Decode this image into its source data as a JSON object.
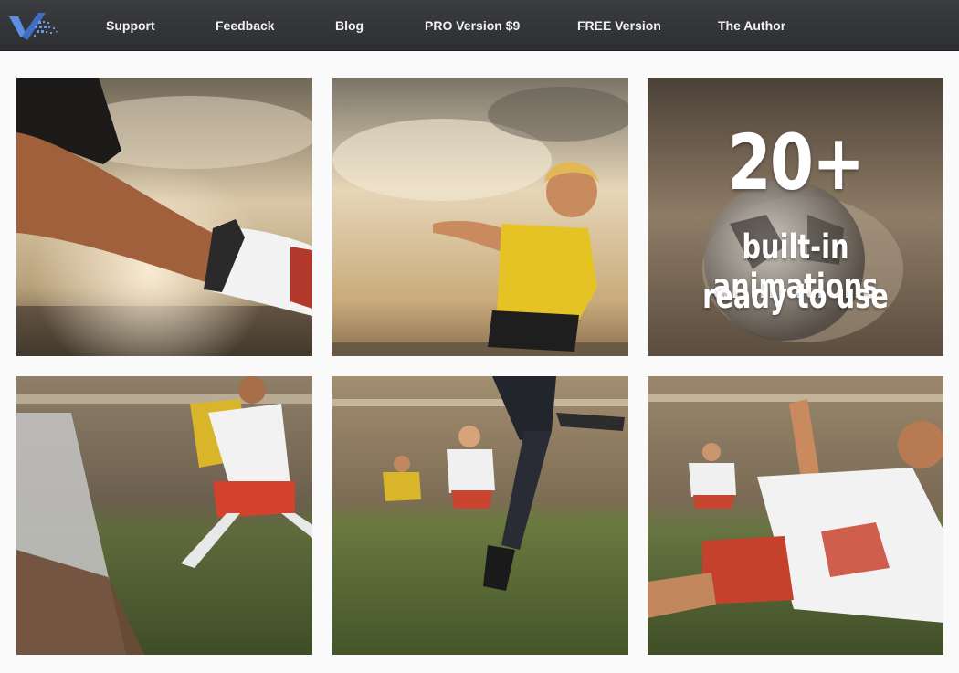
{
  "nav": {
    "items": [
      {
        "label": "Support"
      },
      {
        "label": "Feedback"
      },
      {
        "label": "Blog"
      },
      {
        "label": "PRO Version $9"
      },
      {
        "label": "FREE Version"
      },
      {
        "label": "The Author"
      }
    ]
  },
  "gallery": {
    "promo": {
      "big": "20+",
      "line1": "built-in animations",
      "line2": "ready to use"
    },
    "tiles": [
      {
        "icon": "goalkeeper-glove-photo"
      },
      {
        "icon": "soccer-boy-kick-photo"
      },
      {
        "icon": "soccer-ball-impact-photo"
      },
      {
        "icon": "players-tackle-photo"
      },
      {
        "icon": "player-shot-photo"
      },
      {
        "icon": "player-slide-photo"
      }
    ]
  },
  "colors": {
    "topbar": "#34363a",
    "nav_text": "#f2f2f2",
    "page_bg": "#fafafa",
    "logo_blue": "#4a7fd4"
  }
}
